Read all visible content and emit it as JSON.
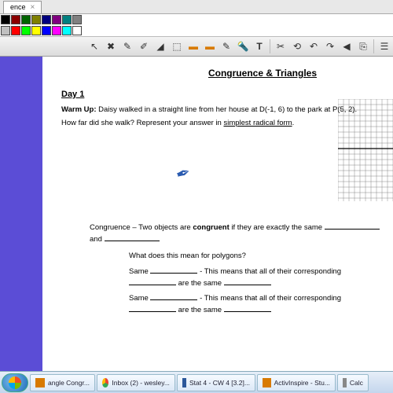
{
  "tab": {
    "title": "ence",
    "close": "×"
  },
  "colors": [
    "black",
    "dred",
    "dgreen",
    "olive",
    "navy",
    "purple",
    "teal",
    "gray",
    "silver",
    "red",
    "lime",
    "yellow",
    "blue",
    "magenta",
    "cyan",
    "white"
  ],
  "tools": [
    "▣",
    "⯀",
    "▦",
    "↖",
    "✖",
    "✎",
    "✐",
    "⌫",
    "⬚",
    "◧",
    "◨",
    "◩",
    "✎",
    "🔦",
    "T",
    "✂",
    "⏮",
    "↶",
    "↷",
    "◀",
    "⎘",
    "⎋"
  ],
  "doc": {
    "title": "Congruence & Triangles",
    "day": "Day 1",
    "warmup_label": "Warm Up:",
    "warmup_text1": "Daisy walked in a straight line from her house at D(-1, 6) to the park at  P(5, 2).",
    "warmup_text2_a": "How far did she walk?  Represent your answer in ",
    "warmup_text2_b": "simplest radical form",
    "warmup_text2_c": ".",
    "cong_line": "Congruence – Two objects are ",
    "cong_bold": "congruent",
    "cong_line2": " if they are exactly the same ",
    "cong_and": " and ",
    "poly_q": "What does this mean for polygons?",
    "same": "Same ",
    "means": " - This means that all of their corresponding ",
    "are_same": " are the same "
  },
  "taskbar": {
    "items": [
      "angle Congr...",
      "Inbox (2) - wesley...",
      "Stat 4 - CW 4 [3.2]...",
      "ActivInspire - Stu...",
      "Calc"
    ]
  }
}
